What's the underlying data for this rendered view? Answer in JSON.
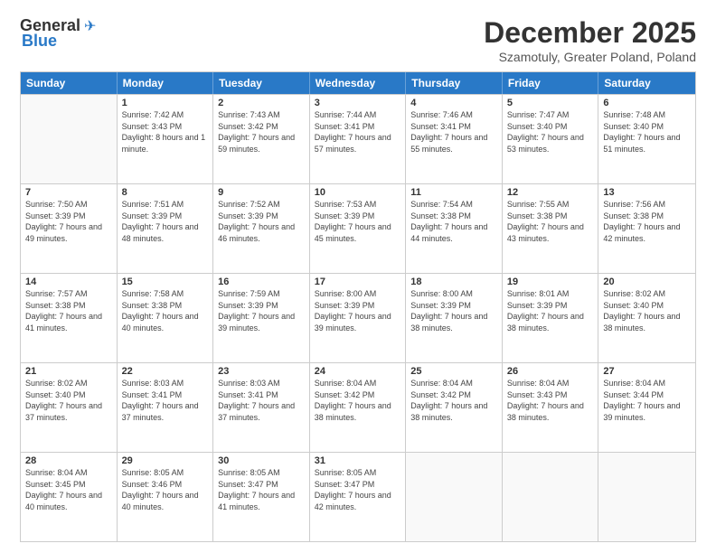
{
  "header": {
    "logo_general": "General",
    "logo_blue": "Blue",
    "month_title": "December 2025",
    "subtitle": "Szamotuly, Greater Poland, Poland"
  },
  "weekdays": [
    "Sunday",
    "Monday",
    "Tuesday",
    "Wednesday",
    "Thursday",
    "Friday",
    "Saturday"
  ],
  "weeks": [
    [
      {
        "day": "",
        "info": ""
      },
      {
        "day": "1",
        "sunrise": "Sunrise: 7:42 AM",
        "sunset": "Sunset: 3:43 PM",
        "daylight": "Daylight: 8 hours and 1 minute."
      },
      {
        "day": "2",
        "sunrise": "Sunrise: 7:43 AM",
        "sunset": "Sunset: 3:42 PM",
        "daylight": "Daylight: 7 hours and 59 minutes."
      },
      {
        "day": "3",
        "sunrise": "Sunrise: 7:44 AM",
        "sunset": "Sunset: 3:41 PM",
        "daylight": "Daylight: 7 hours and 57 minutes."
      },
      {
        "day": "4",
        "sunrise": "Sunrise: 7:46 AM",
        "sunset": "Sunset: 3:41 PM",
        "daylight": "Daylight: 7 hours and 55 minutes."
      },
      {
        "day": "5",
        "sunrise": "Sunrise: 7:47 AM",
        "sunset": "Sunset: 3:40 PM",
        "daylight": "Daylight: 7 hours and 53 minutes."
      },
      {
        "day": "6",
        "sunrise": "Sunrise: 7:48 AM",
        "sunset": "Sunset: 3:40 PM",
        "daylight": "Daylight: 7 hours and 51 minutes."
      }
    ],
    [
      {
        "day": "7",
        "sunrise": "Sunrise: 7:50 AM",
        "sunset": "Sunset: 3:39 PM",
        "daylight": "Daylight: 7 hours and 49 minutes."
      },
      {
        "day": "8",
        "sunrise": "Sunrise: 7:51 AM",
        "sunset": "Sunset: 3:39 PM",
        "daylight": "Daylight: 7 hours and 48 minutes."
      },
      {
        "day": "9",
        "sunrise": "Sunrise: 7:52 AM",
        "sunset": "Sunset: 3:39 PM",
        "daylight": "Daylight: 7 hours and 46 minutes."
      },
      {
        "day": "10",
        "sunrise": "Sunrise: 7:53 AM",
        "sunset": "Sunset: 3:39 PM",
        "daylight": "Daylight: 7 hours and 45 minutes."
      },
      {
        "day": "11",
        "sunrise": "Sunrise: 7:54 AM",
        "sunset": "Sunset: 3:38 PM",
        "daylight": "Daylight: 7 hours and 44 minutes."
      },
      {
        "day": "12",
        "sunrise": "Sunrise: 7:55 AM",
        "sunset": "Sunset: 3:38 PM",
        "daylight": "Daylight: 7 hours and 43 minutes."
      },
      {
        "day": "13",
        "sunrise": "Sunrise: 7:56 AM",
        "sunset": "Sunset: 3:38 PM",
        "daylight": "Daylight: 7 hours and 42 minutes."
      }
    ],
    [
      {
        "day": "14",
        "sunrise": "Sunrise: 7:57 AM",
        "sunset": "Sunset: 3:38 PM",
        "daylight": "Daylight: 7 hours and 41 minutes."
      },
      {
        "day": "15",
        "sunrise": "Sunrise: 7:58 AM",
        "sunset": "Sunset: 3:38 PM",
        "daylight": "Daylight: 7 hours and 40 minutes."
      },
      {
        "day": "16",
        "sunrise": "Sunrise: 7:59 AM",
        "sunset": "Sunset: 3:39 PM",
        "daylight": "Daylight: 7 hours and 39 minutes."
      },
      {
        "day": "17",
        "sunrise": "Sunrise: 8:00 AM",
        "sunset": "Sunset: 3:39 PM",
        "daylight": "Daylight: 7 hours and 39 minutes."
      },
      {
        "day": "18",
        "sunrise": "Sunrise: 8:00 AM",
        "sunset": "Sunset: 3:39 PM",
        "daylight": "Daylight: 7 hours and 38 minutes."
      },
      {
        "day": "19",
        "sunrise": "Sunrise: 8:01 AM",
        "sunset": "Sunset: 3:39 PM",
        "daylight": "Daylight: 7 hours and 38 minutes."
      },
      {
        "day": "20",
        "sunrise": "Sunrise: 8:02 AM",
        "sunset": "Sunset: 3:40 PM",
        "daylight": "Daylight: 7 hours and 38 minutes."
      }
    ],
    [
      {
        "day": "21",
        "sunrise": "Sunrise: 8:02 AM",
        "sunset": "Sunset: 3:40 PM",
        "daylight": "Daylight: 7 hours and 37 minutes."
      },
      {
        "day": "22",
        "sunrise": "Sunrise: 8:03 AM",
        "sunset": "Sunset: 3:41 PM",
        "daylight": "Daylight: 7 hours and 37 minutes."
      },
      {
        "day": "23",
        "sunrise": "Sunrise: 8:03 AM",
        "sunset": "Sunset: 3:41 PM",
        "daylight": "Daylight: 7 hours and 37 minutes."
      },
      {
        "day": "24",
        "sunrise": "Sunrise: 8:04 AM",
        "sunset": "Sunset: 3:42 PM",
        "daylight": "Daylight: 7 hours and 38 minutes."
      },
      {
        "day": "25",
        "sunrise": "Sunrise: 8:04 AM",
        "sunset": "Sunset: 3:42 PM",
        "daylight": "Daylight: 7 hours and 38 minutes."
      },
      {
        "day": "26",
        "sunrise": "Sunrise: 8:04 AM",
        "sunset": "Sunset: 3:43 PM",
        "daylight": "Daylight: 7 hours and 38 minutes."
      },
      {
        "day": "27",
        "sunrise": "Sunrise: 8:04 AM",
        "sunset": "Sunset: 3:44 PM",
        "daylight": "Daylight: 7 hours and 39 minutes."
      }
    ],
    [
      {
        "day": "28",
        "sunrise": "Sunrise: 8:04 AM",
        "sunset": "Sunset: 3:45 PM",
        "daylight": "Daylight: 7 hours and 40 minutes."
      },
      {
        "day": "29",
        "sunrise": "Sunrise: 8:05 AM",
        "sunset": "Sunset: 3:46 PM",
        "daylight": "Daylight: 7 hours and 40 minutes."
      },
      {
        "day": "30",
        "sunrise": "Sunrise: 8:05 AM",
        "sunset": "Sunset: 3:47 PM",
        "daylight": "Daylight: 7 hours and 41 minutes."
      },
      {
        "day": "31",
        "sunrise": "Sunrise: 8:05 AM",
        "sunset": "Sunset: 3:47 PM",
        "daylight": "Daylight: 7 hours and 42 minutes."
      },
      {
        "day": "",
        "info": ""
      },
      {
        "day": "",
        "info": ""
      },
      {
        "day": "",
        "info": ""
      }
    ]
  ]
}
